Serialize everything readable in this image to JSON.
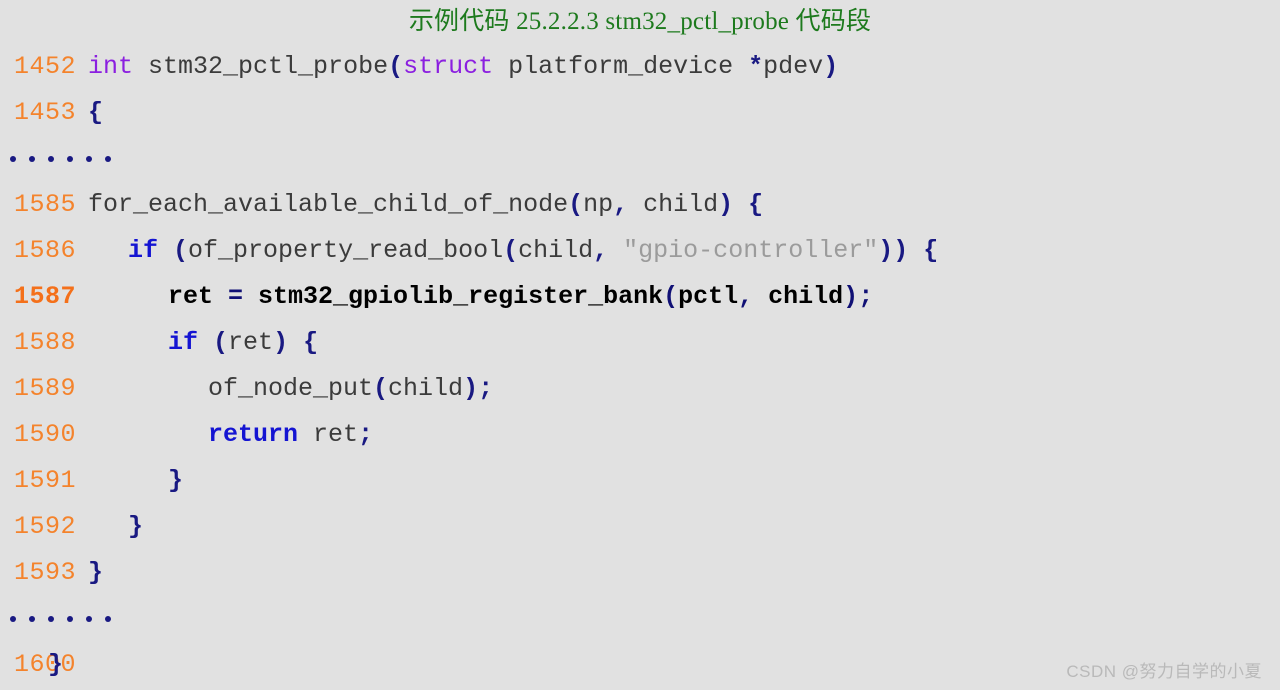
{
  "caption": "示例代码 25.2.2.3 stm32_pctl_probe 代码段",
  "watermark": "CSDN @努力自学的小夏",
  "colors": {
    "background": "#e1e1e1",
    "caption": "#1d7a1d",
    "line_number": "#f4832c",
    "line_number_highlight": "#f4701a",
    "identifier": "#3b3b3b",
    "keyword_type": "#8b1fe0",
    "keyword_control": "#1414d2",
    "punctuation": "#191982",
    "string": "#9b9b9b",
    "watermark": "#b9b9b9"
  },
  "code": {
    "language": "c",
    "highlighted_line": "1587",
    "rows": [
      {
        "type": "code",
        "lineno": "1452",
        "indent": 0,
        "highlight": false,
        "text": "int stm32_pctl_probe(struct platform_device *pdev)",
        "tokens": [
          {
            "t": "int",
            "c": "kw"
          },
          {
            "t": " ",
            "c": "id"
          },
          {
            "t": "stm32_pctl_probe",
            "c": "id"
          },
          {
            "t": "(",
            "c": "punc"
          },
          {
            "t": "struct",
            "c": "kw"
          },
          {
            "t": " platform_device ",
            "c": "id"
          },
          {
            "t": "*",
            "c": "punc"
          },
          {
            "t": "pdev",
            "c": "id"
          },
          {
            "t": ")",
            "c": "punc"
          }
        ]
      },
      {
        "type": "code",
        "lineno": "1453",
        "indent": 0,
        "highlight": false,
        "text": "{",
        "tokens": [
          {
            "t": "{",
            "c": "punc"
          }
        ]
      },
      {
        "type": "dots",
        "dots": 6
      },
      {
        "type": "code",
        "lineno": "1585",
        "indent": 0,
        "highlight": false,
        "text": "for_each_available_child_of_node(np, child) {",
        "tokens": [
          {
            "t": "for_each_available_child_of_node",
            "c": "id"
          },
          {
            "t": "(",
            "c": "punc"
          },
          {
            "t": "np",
            "c": "id"
          },
          {
            "t": ",",
            "c": "punc"
          },
          {
            "t": " child",
            "c": "id"
          },
          {
            "t": ")",
            "c": "punc"
          },
          {
            "t": " ",
            "c": "id"
          },
          {
            "t": "{",
            "c": "punc"
          }
        ]
      },
      {
        "type": "code",
        "lineno": "1586",
        "indent": 1,
        "highlight": false,
        "text": "if (of_property_read_bool(child, \"gpio-controller\")) {",
        "tokens": [
          {
            "t": "if",
            "c": "kwb"
          },
          {
            "t": " ",
            "c": "id"
          },
          {
            "t": "(",
            "c": "punc"
          },
          {
            "t": "of_property_read_bool",
            "c": "id"
          },
          {
            "t": "(",
            "c": "punc"
          },
          {
            "t": "child",
            "c": "id"
          },
          {
            "t": ",",
            "c": "punc"
          },
          {
            "t": " ",
            "c": "id"
          },
          {
            "t": "\"gpio-controller\"",
            "c": "str"
          },
          {
            "t": ")",
            "c": "punc"
          },
          {
            "t": ")",
            "c": "punc"
          },
          {
            "t": " ",
            "c": "id"
          },
          {
            "t": "{",
            "c": "punc"
          }
        ]
      },
      {
        "type": "code",
        "lineno": "1587",
        "indent": 2,
        "highlight": true,
        "text": "ret = stm32_gpiolib_register_bank(pctl, child);",
        "tokens": [
          {
            "t": "ret ",
            "c": "id"
          },
          {
            "t": "=",
            "c": "punc"
          },
          {
            "t": " stm32_gpiolib_register_bank",
            "c": "id"
          },
          {
            "t": "(",
            "c": "punc"
          },
          {
            "t": "pctl",
            "c": "id"
          },
          {
            "t": ",",
            "c": "punc"
          },
          {
            "t": " child",
            "c": "id"
          },
          {
            "t": ")",
            "c": "punc"
          },
          {
            "t": ";",
            "c": "punc"
          }
        ]
      },
      {
        "type": "code",
        "lineno": "1588",
        "indent": 2,
        "highlight": false,
        "text": "if (ret) {",
        "tokens": [
          {
            "t": "if",
            "c": "kwb"
          },
          {
            "t": " ",
            "c": "id"
          },
          {
            "t": "(",
            "c": "punc"
          },
          {
            "t": "ret",
            "c": "id"
          },
          {
            "t": ")",
            "c": "punc"
          },
          {
            "t": " ",
            "c": "id"
          },
          {
            "t": "{",
            "c": "punc"
          }
        ]
      },
      {
        "type": "code",
        "lineno": "1589",
        "indent": 3,
        "highlight": false,
        "text": "of_node_put(child);",
        "tokens": [
          {
            "t": "of_node_put",
            "c": "id"
          },
          {
            "t": "(",
            "c": "punc"
          },
          {
            "t": "child",
            "c": "id"
          },
          {
            "t": ")",
            "c": "punc"
          },
          {
            "t": ";",
            "c": "punc"
          }
        ]
      },
      {
        "type": "code",
        "lineno": "1590",
        "indent": 3,
        "highlight": false,
        "text": "return ret;",
        "tokens": [
          {
            "t": "return",
            "c": "kwb"
          },
          {
            "t": " ret",
            "c": "id"
          },
          {
            "t": ";",
            "c": "punc"
          }
        ]
      },
      {
        "type": "code",
        "lineno": "1591",
        "indent": 2,
        "highlight": false,
        "text": "}",
        "tokens": [
          {
            "t": "}",
            "c": "punc"
          }
        ]
      },
      {
        "type": "code",
        "lineno": "1592",
        "indent": 1,
        "highlight": false,
        "text": "}",
        "tokens": [
          {
            "t": "}",
            "c": "punc"
          }
        ]
      },
      {
        "type": "code",
        "lineno": "1593",
        "indent": 0,
        "highlight": false,
        "text": "}",
        "tokens": [
          {
            "t": "}",
            "c": "punc"
          }
        ]
      },
      {
        "type": "dots",
        "dots": 6
      },
      {
        "type": "code",
        "lineno": "1600",
        "indent": -1,
        "highlight": false,
        "text": "}",
        "tokens": [
          {
            "t": "}",
            "c": "punc"
          }
        ]
      }
    ]
  }
}
